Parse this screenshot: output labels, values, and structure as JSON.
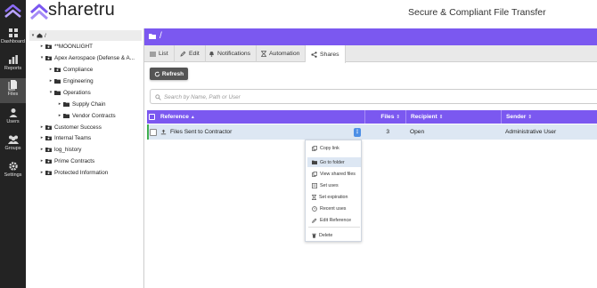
{
  "brand": {
    "name": "sharetru",
    "tagline": "Secure & Compliant File Transfer"
  },
  "rail": [
    {
      "label": "Dashboard",
      "icon": "dashboard-icon"
    },
    {
      "label": "Reports",
      "icon": "reports-icon"
    },
    {
      "label": "Files",
      "icon": "files-icon",
      "active": true
    },
    {
      "label": "Users",
      "icon": "users-icon"
    },
    {
      "label": "Groups",
      "icon": "groups-icon"
    },
    {
      "label": "Settings",
      "icon": "settings-icon"
    }
  ],
  "tree": {
    "root": "/",
    "items": [
      {
        "label": "**MOONLIGHT"
      },
      {
        "label": "Apex Aerospace (Defense & A..."
      },
      {
        "label": "Compliance"
      },
      {
        "label": "Engineering"
      },
      {
        "label": "Operations"
      },
      {
        "label": "Supply Chain"
      },
      {
        "label": "Vendor Contracts"
      },
      {
        "label": "Customer Success"
      },
      {
        "label": "Internal Teams"
      },
      {
        "label": "log_history"
      },
      {
        "label": "Prime Contracts"
      },
      {
        "label": "Protected Information"
      }
    ]
  },
  "path": "/",
  "tabs": {
    "list": "List",
    "edit": "Edit",
    "notifications": "Notifications",
    "automation": "Automation",
    "shares": "Shares"
  },
  "toolbar": {
    "refresh": "Refresh"
  },
  "search": {
    "placeholder": "Search by Name, Path or User"
  },
  "table": {
    "headers": {
      "reference": "Reference",
      "files": "Files",
      "recipient": "Recipient",
      "sender": "Sender"
    },
    "sort_up": "▲",
    "sort_both": "⇕",
    "row": {
      "reference": "Files Sent to Contractor",
      "files": "3",
      "recipient": "Open",
      "sender": "Administrative User",
      "kebab": "⋮"
    }
  },
  "context_menu": {
    "copy_link": "Copy link",
    "go_to_folder": "Go to folder",
    "view_shared_files": "View shared files",
    "set_uses": "Set uses",
    "set_expiration": "Set expiration",
    "recent_uses": "Recent uses",
    "edit_reference": "Edit Reference",
    "delete": "Delete"
  },
  "colors": {
    "accent": "#7b58f0",
    "rail": "#232323",
    "row_highlight": "#dde7f3",
    "kebab": "#4d8fe6"
  }
}
